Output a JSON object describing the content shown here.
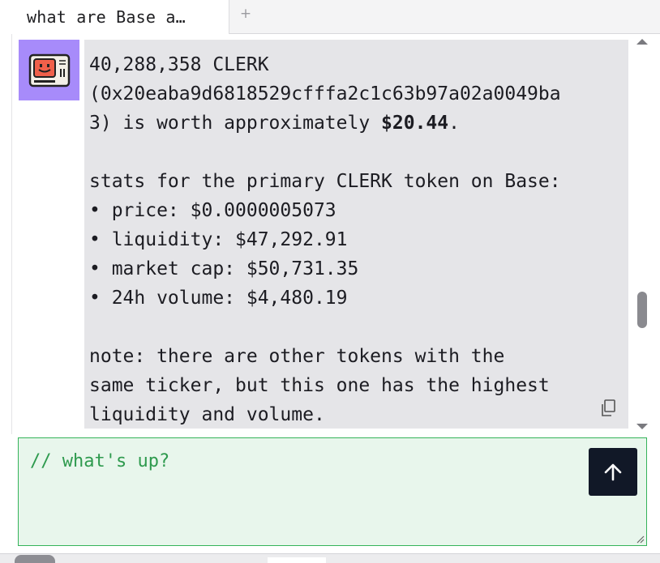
{
  "tab": {
    "title": "what are Base a…",
    "add_label": "+"
  },
  "avatar": {
    "icon": "robot-computer-icon"
  },
  "message": {
    "line1": "40,288,358 CLERK",
    "line2": "(0x20eaba9d6818529cfffa2c1c63b97a02a0049ba",
    "line3_prefix": "3) is worth approximately ",
    "line3_amount": "$20.44",
    "line3_suffix": ".",
    "stats_heading": "stats for the primary CLERK token on Base:",
    "stats": [
      "• price: $0.0000005073",
      "• liquidity: $47,292.91",
      "• market cap: $50,731.35",
      "• 24h volume: $4,480.19"
    ],
    "note_line1": "note: there are other tokens with the",
    "note_line2": "same ticker, but this one has the highest",
    "note_line3": "liquidity and volume."
  },
  "composer": {
    "placeholder": "// what's up?"
  },
  "colors": {
    "accent_green": "#35b35a",
    "send_bg": "#111827",
    "avatar_bg": "#a78bfa",
    "bubble_bg": "#e5e5e8"
  }
}
